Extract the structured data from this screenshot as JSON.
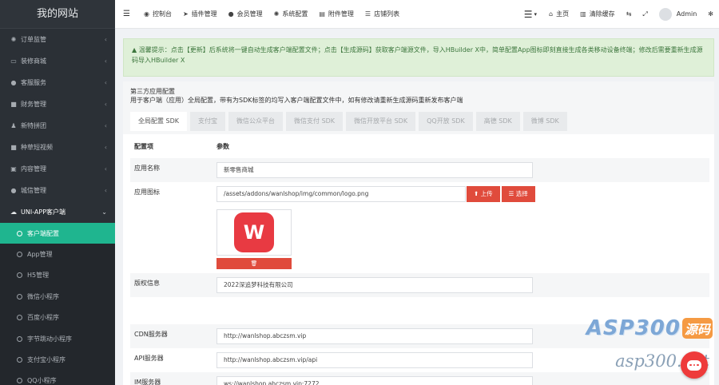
{
  "sidebar": {
    "brand": "我的网站",
    "items": [
      {
        "label": "订单监管",
        "icon": "gear-icon",
        "glyph": "✺"
      },
      {
        "label": "装修商城",
        "icon": "monitor-icon",
        "glyph": "▭"
      },
      {
        "label": "客服服务",
        "icon": "chat-icon",
        "glyph": "●"
      },
      {
        "label": "财务管理",
        "icon": "bookmark-icon",
        "glyph": "■"
      },
      {
        "label": "新特拼团",
        "icon": "users-icon",
        "glyph": "♟"
      },
      {
        "label": "种草短视频",
        "icon": "video-icon",
        "glyph": "■"
      },
      {
        "label": "内容管理",
        "icon": "edit-icon",
        "glyph": "▣"
      },
      {
        "label": "城信管理",
        "icon": "wechat-icon",
        "glyph": "●"
      }
    ],
    "open_item": {
      "label": "UNI-APP客户端",
      "icon": "cloud-icon",
      "glyph": "☁"
    },
    "sub_items": [
      "客户端配置",
      "App管理",
      "H5管理",
      "微信小程序",
      "百度小程序",
      "字节跳动小程序",
      "支付宝小程序",
      "QQ小程序"
    ],
    "arrow_closed": "‹",
    "arrow_open": "⌄"
  },
  "topbar": {
    "nav": [
      {
        "label": "控制台",
        "icon": "dashboard-icon",
        "glyph": "◉"
      },
      {
        "label": "插件管理",
        "icon": "rocket-icon",
        "glyph": "➤"
      },
      {
        "label": "会员管理",
        "icon": "user-icon",
        "glyph": "●"
      },
      {
        "label": "系统配置",
        "icon": "cog-icon",
        "glyph": "✺"
      },
      {
        "label": "附件管理",
        "icon": "file-icon",
        "glyph": "▤"
      },
      {
        "label": "店铺列表",
        "icon": "list-icon",
        "glyph": "☰"
      }
    ],
    "home_label": "主页",
    "clear_cache_label": "清除缓存",
    "admin_label": "Admin"
  },
  "alert": {
    "text": "▲ 温馨提示：点击【更新】后系统将一键自动生成客户端配置文件；点击【生成源码】获取客户端源文件，导入HBuilder X中，简单配置App图标即刻直接生成各类移动设备终端；修改后需要重新生成源码导入HBuilder X"
  },
  "panel": {
    "title": "第三方应用配置",
    "desc": "用于客户端（应用）全局配置，带有为SDK标签的均写入客户端配置文件中，如有修改请重新生成源码重新发布客户端",
    "tabs": [
      "全局配置 SDK",
      "支付宝",
      "微信公众平台",
      "微信支付 SDK",
      "微信开放平台 SDK",
      "QQ开放 SDK",
      "高德 SDK",
      "微博 SDK"
    ],
    "active_tab": 0
  },
  "form": {
    "header_key": "配置项",
    "header_val": "参数",
    "app_name_label": "应用名称",
    "app_name_value": "新零售商城",
    "app_icon_label": "应用图标",
    "app_icon_value": "/assets/addons/wanlshop/img/common/logo.png",
    "upload_label": "⬆ 上传",
    "choose_label": "☰ 选择",
    "delete_glyph": "🗑",
    "copyright_label": "版权信息",
    "copyright_value": "2022深追梦科技有限公司",
    "cdn_label": "CDN服务器",
    "cdn_value": "http://wanlshop.abczsm.vip",
    "api_label": "API服务器",
    "api_value": "http://wanlshop.abczsm.vip/api",
    "im_label": "IM服务器",
    "im_value": "ws://wanlshop.abczsm.vip:7272"
  },
  "watermark": {
    "brand": "ASP300",
    "brand_suffix": "源码",
    "url": "asp300.net"
  },
  "colors": {
    "sidebar_bg": "#2b3036",
    "active_green": "#1fb58f",
    "danger_red": "#e04b3c",
    "alert_bg": "#dff0d8"
  }
}
